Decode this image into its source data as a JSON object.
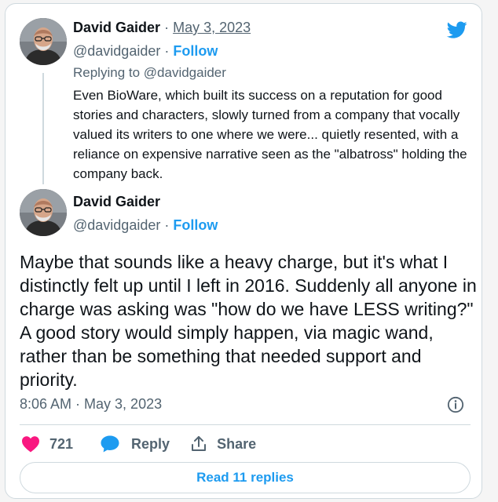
{
  "quoted_tweet": {
    "author_name": "David Gaider",
    "separator": "·",
    "date": "May 3, 2023",
    "handle": "@davidgaider",
    "follow_label": "Follow",
    "replying_to": "Replying to @davidgaider",
    "text": "Even BioWare, which built its success on a reputation for good stories and characters, slowly turned from a company that vocally valued its writers to one where we were... quietly resented, with a reliance on expensive narrative seen as the \"albatross\" holding the company back."
  },
  "main_tweet": {
    "author_name": "David Gaider",
    "handle": "@davidgaider",
    "separator": "·",
    "follow_label": "Follow",
    "text": "Maybe that sounds like a heavy charge, but it's what I distinctly felt up until I left in 2016. Suddenly all anyone in charge was asking was \"how do we have LESS writing?\" A good story would simply happen, via magic wand, rather than be something that needed support and priority.",
    "timestamp": "8:06 AM · May 3, 2023"
  },
  "actions": {
    "like_count": "721",
    "reply_label": "Reply",
    "share_label": "Share"
  },
  "read_replies_label": "Read 11 replies",
  "icons": {
    "brand": "twitter-bird-icon",
    "like": "heart-icon",
    "reply": "speech-bubble-icon",
    "share": "share-upload-icon",
    "info": "info-icon"
  },
  "colors": {
    "accent": "#1d9bf0",
    "like": "#f91880",
    "muted_text": "#536471",
    "border": "#cfd9de"
  }
}
